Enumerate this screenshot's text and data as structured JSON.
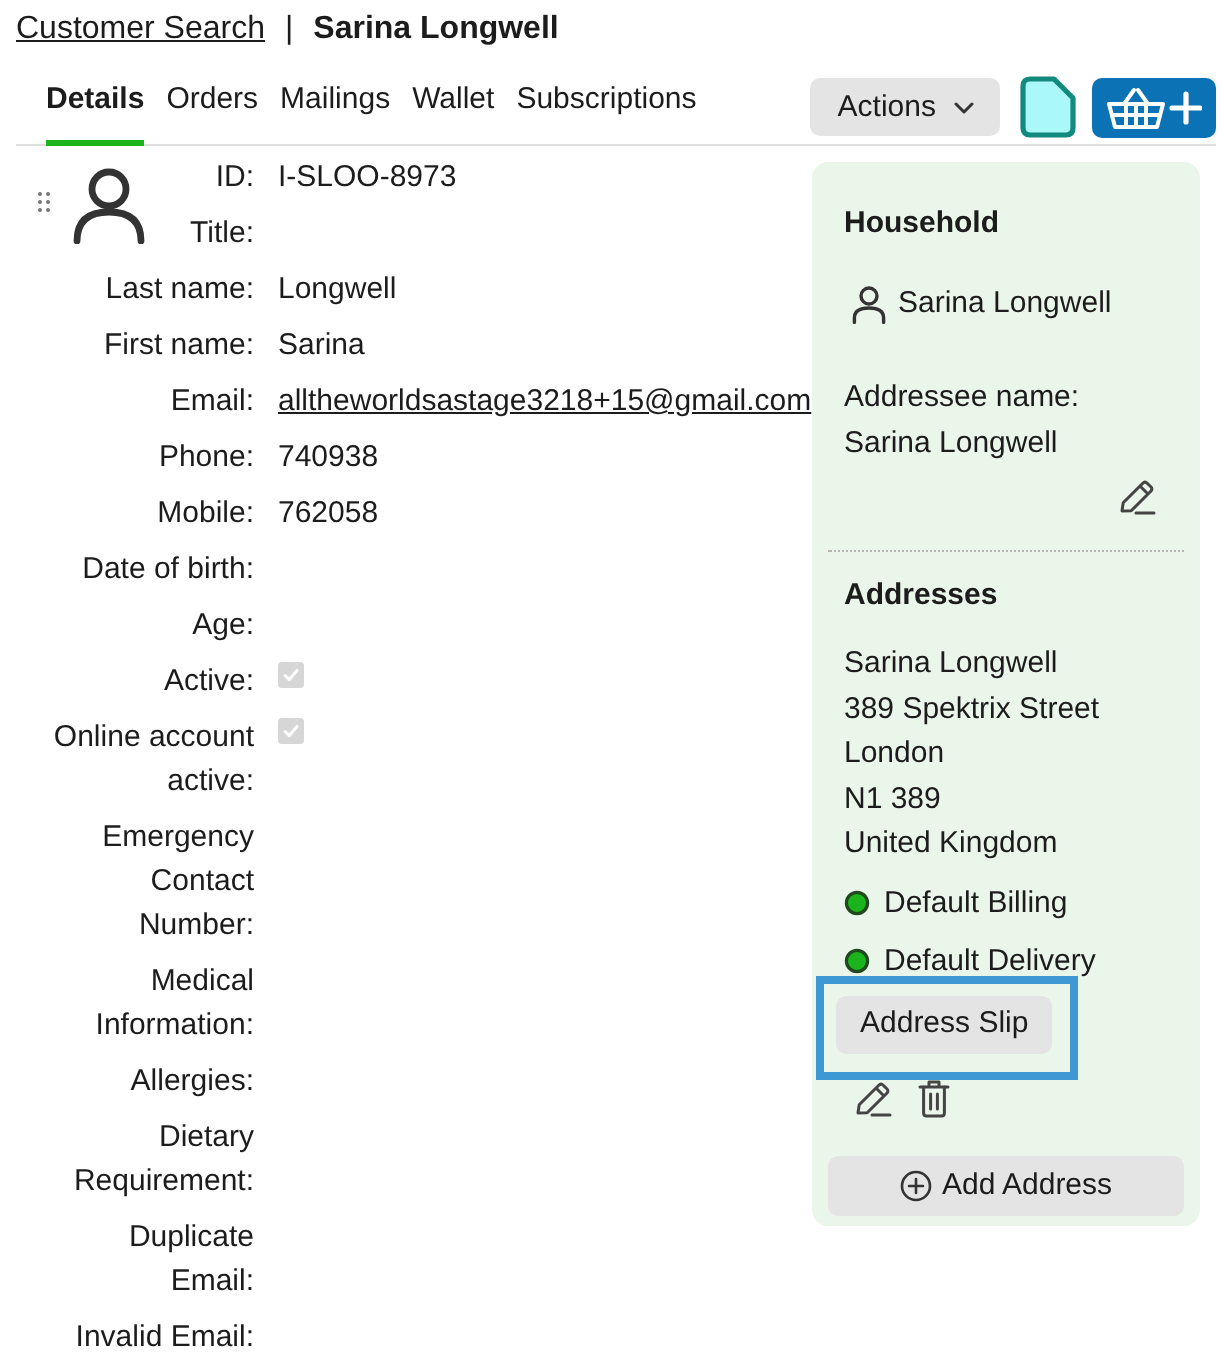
{
  "breadcrumb": {
    "link": "Customer Search",
    "separator": "|",
    "current": "Sarina Longwell"
  },
  "tabs": [
    {
      "label": "Details",
      "selected": true
    },
    {
      "label": "Orders",
      "selected": false
    },
    {
      "label": "Mailings",
      "selected": false
    },
    {
      "label": "Wallet",
      "selected": false
    },
    {
      "label": "Subscriptions",
      "selected": false
    }
  ],
  "toolbar": {
    "actions": {
      "label": "Actions"
    }
  },
  "fields": [
    {
      "kind": "text",
      "label": "ID:",
      "value": "I-SLOO-8973"
    },
    {
      "kind": "text",
      "label": "Title:"
    },
    {
      "kind": "text",
      "label": "Last name:",
      "value": "Longwell"
    },
    {
      "kind": "text",
      "label": "First name:",
      "value": "Sarina"
    },
    {
      "kind": "link",
      "label": "Email:",
      "value": "alltheworldsastage3218+15@gmail.com"
    },
    {
      "kind": "text",
      "label": "Phone:",
      "value": "740938"
    },
    {
      "kind": "text",
      "label": "Mobile:",
      "value": "762058"
    },
    {
      "kind": "text",
      "label": "Date of birth:"
    },
    {
      "kind": "text",
      "label": "Age:"
    },
    {
      "kind": "checkbox",
      "label": "Active:",
      "checked": true,
      "disabled": true
    },
    {
      "kind": "checkbox",
      "label": "Online account active:",
      "checked": true,
      "disabled": true
    },
    {
      "kind": "text",
      "label": "Emergency Contact Number:"
    },
    {
      "kind": "text",
      "label": "Medical Information:"
    },
    {
      "kind": "text",
      "label": "Allergies:"
    },
    {
      "kind": "text",
      "label": "Dietary Requirement:"
    },
    {
      "kind": "text",
      "label": "Duplicate Email:"
    },
    {
      "kind": "text",
      "label": "Invalid Email:"
    }
  ],
  "household": {
    "title": "Household",
    "member": "Sarina Longwell",
    "addressee_label": "Addressee name:",
    "addressee_name": "Sarina Longwell"
  },
  "addresses": {
    "title": "Addresses",
    "items": [
      {
        "lines": [
          "Sarina Longwell",
          "389 Spektrix Street",
          "London",
          "N1 389",
          "United Kingdom"
        ],
        "flags": [
          {
            "label": "Default Billing",
            "active": true
          },
          {
            "label": "Default Delivery",
            "active": true
          }
        ],
        "slip_button": {
          "label": "Address Slip",
          "focused": true
        }
      }
    ],
    "add_button": {
      "label": "Add Address"
    }
  }
}
